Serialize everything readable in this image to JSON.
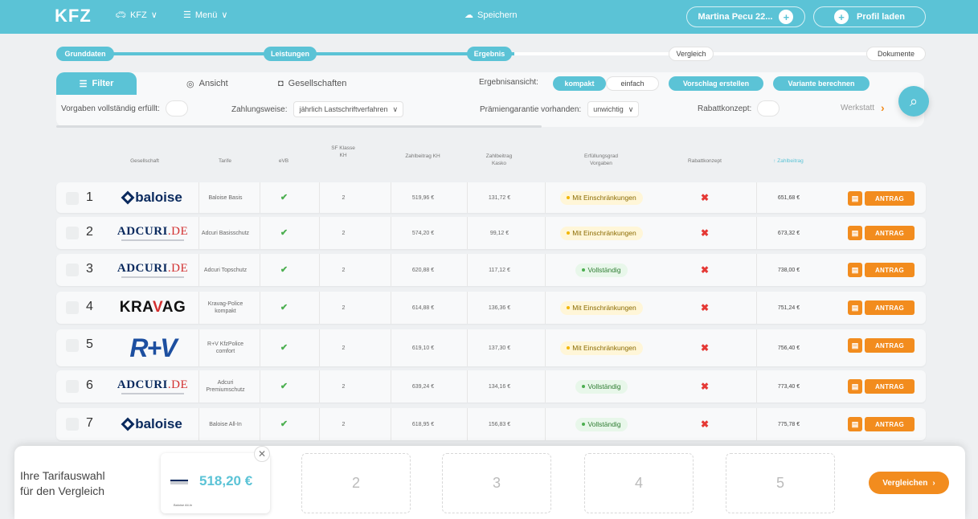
{
  "topbar": {
    "logo": "KFZ",
    "vehicle": "KFZ",
    "menu": "Menü",
    "save": "Speichern",
    "user": "Martina Pecu 22...",
    "load_profile": "Profil laden"
  },
  "steps": [
    "Grunddaten",
    "Leistungen",
    "Ergebnis",
    "Vergleich",
    "Dokumente"
  ],
  "filter": {
    "tab_filter": "Filter",
    "tab_view": "Ansicht",
    "tab_companies": "Gesellschaften",
    "result_view_label": "Ergebnisansicht:",
    "result_view_compact": "kompakt",
    "result_view_simple": "einfach",
    "suggest_btn": "Vorschlag erstellen",
    "variant_btn": "Variante berechnen",
    "requirements_label": "Vorgaben vollständig erfüllt:",
    "payment_label": "Zahlungsweise:",
    "payment_value": "jährlich Lastschriftverfahren",
    "guarantee_label": "Prämiengarantie vorhanden:",
    "guarantee_value": "unwichtig",
    "discount_label": "Rabattkonzept:",
    "workshop_label": "Werkstatt"
  },
  "table": {
    "headers": {
      "company": "Gesellschaft",
      "tariff": "Tarife",
      "evb": "eVB",
      "sf": "SF Klasse KH",
      "kh": "Zahlbeitrag KH",
      "kasko": "Zahlbeitrag Kasko",
      "fulfill": "Erfüllungsgrad Vorgaben",
      "discount": "Rabattkonzept",
      "total": "Zahlbeitrag"
    },
    "rows": [
      {
        "num": "1",
        "logo": "baloise",
        "tariff": "Baloise Basis",
        "sf": "2",
        "kh": "519,96 €",
        "kasko": "131,72 €",
        "status": "Mit Einschränkungen",
        "status_type": "warn",
        "total": "651,68 €",
        "action": "ANTRAG"
      },
      {
        "num": "2",
        "logo": "adcuri",
        "tariff": "Adcuri Basisschutz",
        "sf": "2",
        "kh": "574,20 €",
        "kasko": "99,12 €",
        "status": "Mit Einschränkungen",
        "status_type": "warn",
        "total": "673,32 €",
        "action": "ANTRAG"
      },
      {
        "num": "3",
        "logo": "adcuri",
        "tariff": "Adcuri Topschutz",
        "sf": "2",
        "kh": "620,88 €",
        "kasko": "117,12 €",
        "status": "Vollständig",
        "status_type": "ok",
        "total": "738,00 €",
        "action": "ANTRAG"
      },
      {
        "num": "4",
        "logo": "kravag",
        "tariff": "Kravag-Police kompakt",
        "sf": "2",
        "kh": "614,88 €",
        "kasko": "136,36 €",
        "status": "Mit Einschränkungen",
        "status_type": "warn",
        "total": "751,24 €",
        "action": "ANTRAG"
      },
      {
        "num": "5",
        "logo": "rv",
        "tariff": "R+V KfzPolice comfort",
        "sf": "2",
        "kh": "619,10 €",
        "kasko": "137,30 €",
        "status": "Mit Einschränkungen",
        "status_type": "warn",
        "total": "756,40 €",
        "action": "ANTRAG"
      },
      {
        "num": "6",
        "logo": "adcuri",
        "tariff": "Adcuri Premiumschutz",
        "sf": "2",
        "kh": "639,24 €",
        "kasko": "134,16 €",
        "status": "Vollständig",
        "status_type": "ok",
        "total": "773,40 €",
        "action": "ANTRAG"
      },
      {
        "num": "7",
        "logo": "baloise",
        "tariff": "Baloise All-In",
        "sf": "2",
        "kh": "618,95 €",
        "kasko": "156,83 €",
        "status": "Vollständig",
        "status_type": "ok",
        "total": "775,78 €",
        "action": "ANTRAG"
      }
    ]
  },
  "compare": {
    "label_line1": "Ihre Tarifauswahl",
    "label_line2": "für den Vergleich",
    "selected_price": "518,20 €",
    "selected_sub": "Baloise All-In",
    "slots": [
      "2",
      "3",
      "4",
      "5"
    ],
    "button": "Vergleichen"
  },
  "colors": {
    "accent": "#5bc3d6",
    "action": "#f28c1e",
    "ok": "#4caf50",
    "error": "#e53935"
  }
}
